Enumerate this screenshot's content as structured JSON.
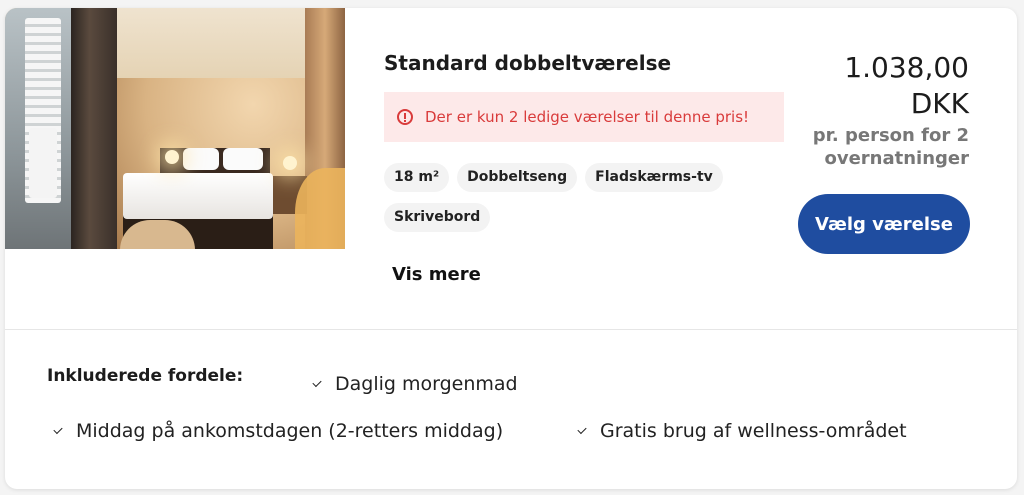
{
  "room": {
    "title": "Standard dobbeltværelse",
    "alert": "Der er kun 2 ledige værelser til denne pris!",
    "features": [
      "18 m²",
      "Dobbeltseng",
      "Fladskærms-tv",
      "Skrivebord"
    ],
    "show_more": "Vis mere",
    "photo_alt": "Hotel room with double bed"
  },
  "price": {
    "amount": "1.038,00",
    "currency": "DKK",
    "note": "pr. person for 2 overnatninger",
    "button": "Vælg værelse"
  },
  "benefits": {
    "label": "Inkluderede fordele:",
    "items": [
      "Daglig morgenmad",
      "Middag på ankomstdagen (2-retters middag)",
      "Gratis brug af wellness-området"
    ]
  },
  "colors": {
    "accent": "#1f4da0",
    "alert_text": "#d93b3b",
    "alert_bg": "#fde9e9"
  }
}
